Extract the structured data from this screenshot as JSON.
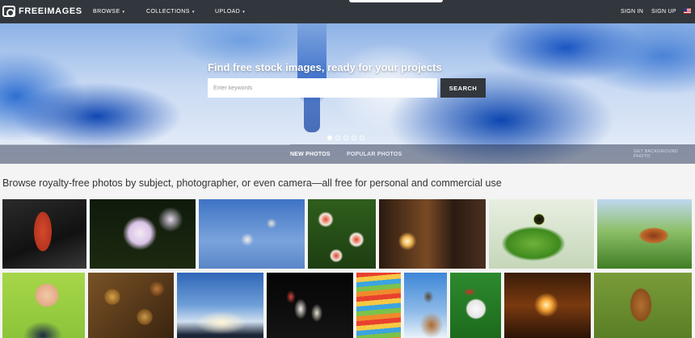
{
  "brand": {
    "name": "FREEIMAGES"
  },
  "nav": {
    "browse": "BROWSE",
    "collections": "COLLECTIONS",
    "upload": "UPLOAD",
    "caret": "▾"
  },
  "auth": {
    "sign_in": "SIGN IN",
    "sign_up": "SIGN UP"
  },
  "hero": {
    "title": "Find free stock images, ready for your projects",
    "search_placeholder": "Enter keywords",
    "search_button": "SEARCH",
    "slide_count": 5,
    "active_slide": 1,
    "tabs": [
      "NEW PHOTOS",
      "POPULAR PHOTOS"
    ],
    "get_background": "GET BACKGROUND PHOTO"
  },
  "tagline": "Browse royalty-free photos by subject, photographer, or even camera—all free for personal and commercial use",
  "photos": {
    "row1": [
      "red-parrot-head",
      "white-water-lily",
      "pussy-willow",
      "red-white-tulips",
      "sunset-building",
      "green-frog",
      "grasshopper"
    ],
    "row2": [
      "baby-on-phone",
      "coins",
      "sun-rays-sky",
      "white-tulips",
      "colorful-paper",
      "ibex-on-rock",
      "white-rabbit",
      "forest-sunburst",
      "foal"
    ]
  },
  "colors": {
    "topbar": "#32373d",
    "search_button": "#32373d",
    "hero_blue": "#0f47b3"
  }
}
